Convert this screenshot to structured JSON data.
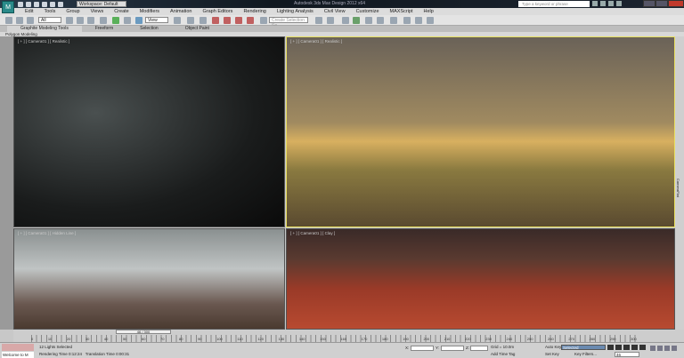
{
  "title_bar": {
    "app_title": "Autodesk 3ds Max Design 2012 x64",
    "workspace": "Workspace: Default",
    "search_placeholder": "Type a keyword or phrase"
  },
  "menu": [
    "Edit",
    "Tools",
    "Group",
    "Views",
    "Create",
    "Modifiers",
    "Animation",
    "Graph Editors",
    "Rendering",
    "Lighting Analysis",
    "Civil View",
    "Customize",
    "MAXScript",
    "Help"
  ],
  "toolbar": {
    "filter": "All",
    "ref_coord": "View",
    "named_selection": "Create Selection Se"
  },
  "ribbon": {
    "tabs": [
      "Graphite Modeling Tools",
      "Freeform",
      "Selection",
      "Object Paint"
    ],
    "active_tab": 0,
    "panel": "Polygon Modeling"
  },
  "viewports": [
    {
      "label": "[ + ] [ Camera01 ] [ Realistic ]"
    },
    {
      "label": "[ + ] [ Camera01 ] [ Realistic ]",
      "active": true
    },
    {
      "label": "[ + ] [ Camera01 ] [ Hidden Line ]"
    },
    {
      "label": "[ + ] [ Camera01 ] [ Clay ]"
    }
  ],
  "side_label": "CameraFlat",
  "timeline": {
    "slider": "46 / 300",
    "ticks": [
      "0",
      "10",
      "20",
      "30",
      "40",
      "50",
      "60",
      "70",
      "80",
      "90",
      "100",
      "110",
      "120",
      "130",
      "140",
      "150",
      "160",
      "170",
      "180",
      "190",
      "200",
      "210",
      "220",
      "230",
      "240",
      "250",
      "260",
      "270",
      "280",
      "290",
      "300"
    ]
  },
  "status": {
    "welcome": "Welcome to M",
    "selection": "12 Lights Selected",
    "render_time": "Rendering Time  0:12:24",
    "translation_time": "Translation Time  0:00:31",
    "x_label": "X:",
    "y_label": "Y:",
    "z_label": "Z:",
    "grid": "Grid = 10.0m",
    "add_time_tag": "Add Time Tag",
    "auto_key": "Auto Key",
    "set_key": "Set Key",
    "key_mode": "Selected",
    "key_filters": "Key Filters...",
    "frame": "46"
  }
}
